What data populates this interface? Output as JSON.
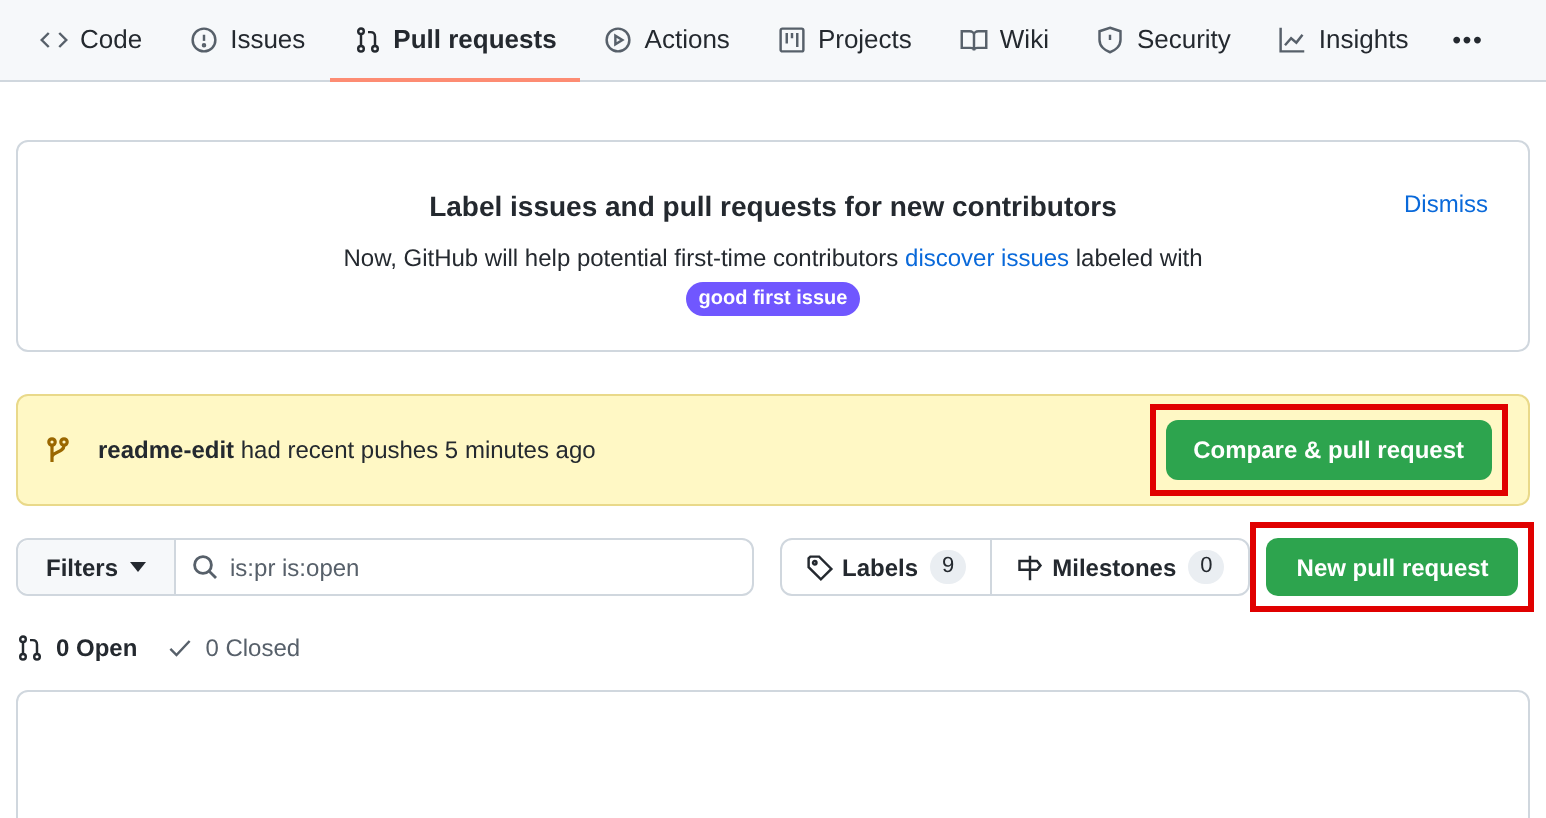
{
  "tabs": [
    {
      "kind": "code",
      "label": "Code",
      "selected": false
    },
    {
      "kind": "issue",
      "label": "Issues",
      "selected": false
    },
    {
      "kind": "pr",
      "label": "Pull requests",
      "selected": true
    },
    {
      "kind": "play",
      "label": "Actions",
      "selected": false
    },
    {
      "kind": "project",
      "label": "Projects",
      "selected": false
    },
    {
      "kind": "book",
      "label": "Wiki",
      "selected": false
    },
    {
      "kind": "shield",
      "label": "Security",
      "selected": false
    },
    {
      "kind": "graph",
      "label": "Insights",
      "selected": false
    }
  ],
  "more": "•••",
  "notice": {
    "title": "Label issues and pull requests for new contributors",
    "text_before": "Now, GitHub will help potential first-time contributors",
    "link": "discover issues",
    "text_after": "labeled with",
    "label": "good first issue",
    "dismiss": "Dismiss"
  },
  "push_banner": {
    "branch": "readme-edit",
    "text": "had recent pushes 5 minutes ago",
    "button": "Compare & pull request",
    "highlighted": true
  },
  "filters": {
    "button": "Filters",
    "search_value": "is:pr is:open",
    "labels": "Labels",
    "labels_count": "9",
    "milestones": "Milestones",
    "milestones_count": "0",
    "new_button": "New pull request",
    "highlighted": true
  },
  "states": [
    {
      "kind": "pr",
      "label": "0 Open",
      "selected": true
    },
    {
      "kind": "check",
      "label": "0 Closed",
      "selected": false
    }
  ]
}
